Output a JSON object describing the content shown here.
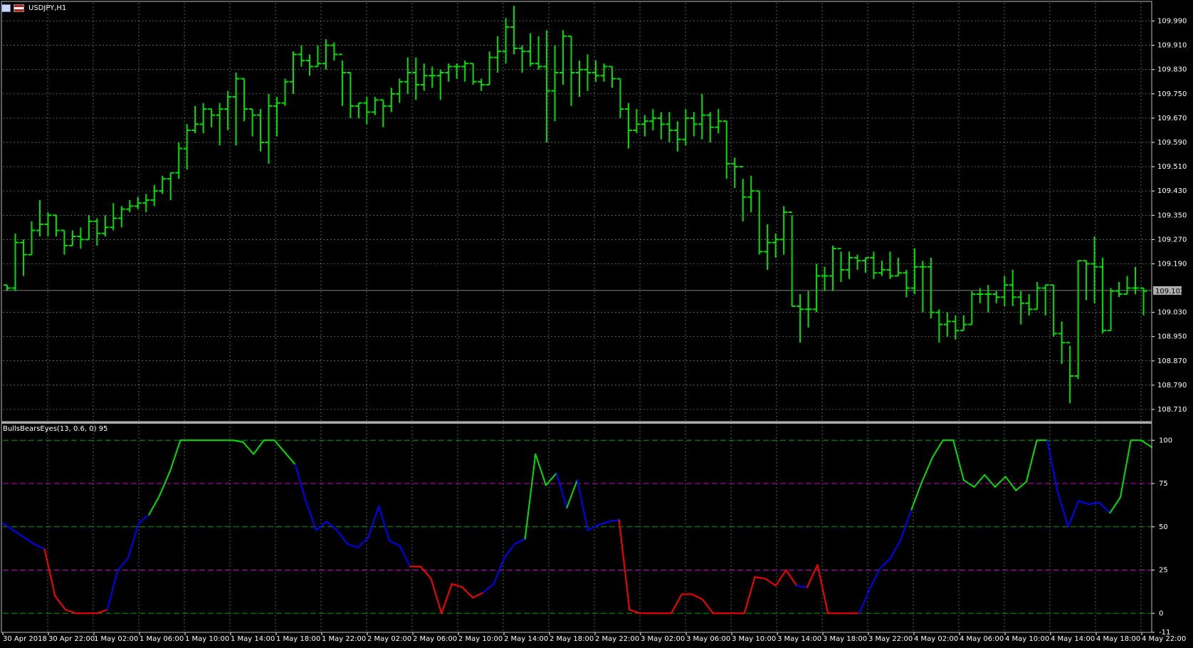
{
  "header": {
    "symbol_title": "USDJPY,H1"
  },
  "subwindow": {
    "title": "BullsBearsEyes(13, 0.6, 0) 95"
  },
  "price_axis": {
    "labels": [
      "109.990",
      "109.910",
      "109.830",
      "109.750",
      "109.670",
      "109.590",
      "109.510",
      "109.430",
      "109.350",
      "109.270",
      "109.190",
      "109.030",
      "108.950",
      "108.870",
      "108.790",
      "108.710"
    ],
    "current_price": "109.102"
  },
  "indicator_axis": {
    "labels": [
      "100",
      "75",
      "50",
      "25",
      "0",
      "-11"
    ]
  },
  "time_axis": {
    "labels": [
      "30 Apr 2018",
      "30 Apr 22:00",
      "1 May 02:00",
      "1 May 06:00",
      "1 May 10:00",
      "1 May 14:00",
      "1 May 18:00",
      "1 May 22:00",
      "2 May 02:00",
      "2 May 06:00",
      "2 May 10:00",
      "2 May 14:00",
      "2 May 18:00",
      "2 May 22:00",
      "3 May 02:00",
      "3 May 06:00",
      "3 May 10:00",
      "3 May 14:00",
      "3 May 18:00",
      "3 May 22:00",
      "4 May 02:00",
      "4 May 06:00",
      "4 May 10:00",
      "4 May 14:00",
      "4 May 18:00",
      "4 May 22:00"
    ]
  },
  "colors": {
    "background": "#000000",
    "grid": "#c0c0c0",
    "bars": "#00e000",
    "bull": "#00e000",
    "neutral": "#0000ff",
    "bear": "#ff0000",
    "level_75_25": "#c000c0",
    "level_100_50_0": "#00a000",
    "axis_text": "#ffffff"
  },
  "chart_data": [
    {
      "type": "ohlc",
      "symbol": "USDJPY",
      "timeframe": "H1",
      "ylim": [
        108.67,
        110.05
      ],
      "bars": [
        [
          109.12,
          109.12,
          109.1,
          109.11
        ],
        [
          109.11,
          109.29,
          109.1,
          109.26
        ],
        [
          109.26,
          109.27,
          109.15,
          109.22
        ],
        [
          109.22,
          109.33,
          109.22,
          109.3
        ],
        [
          109.3,
          109.4,
          109.28,
          109.32
        ],
        [
          109.32,
          109.36,
          109.28,
          109.35
        ],
        [
          109.35,
          109.35,
          109.28,
          109.3
        ],
        [
          109.3,
          109.3,
          109.22,
          109.25
        ],
        [
          109.25,
          109.3,
          109.25,
          109.28
        ],
        [
          109.28,
          109.31,
          109.24,
          109.27
        ],
        [
          109.27,
          109.35,
          109.27,
          109.33
        ],
        [
          109.33,
          109.34,
          109.25,
          109.29
        ],
        [
          109.29,
          109.35,
          109.28,
          109.31
        ],
        [
          109.31,
          109.39,
          109.3,
          109.34
        ],
        [
          109.34,
          109.38,
          109.31,
          109.37
        ],
        [
          109.37,
          109.4,
          109.36,
          109.38
        ],
        [
          109.38,
          109.41,
          109.37,
          109.39
        ],
        [
          109.39,
          109.42,
          109.36,
          109.4
        ],
        [
          109.4,
          109.45,
          109.38,
          109.43
        ],
        [
          109.43,
          109.48,
          109.42,
          109.47
        ],
        [
          109.47,
          109.49,
          109.4,
          109.49
        ],
        [
          109.49,
          109.59,
          109.47,
          109.57
        ],
        [
          109.57,
          109.65,
          109.5,
          109.63
        ],
        [
          109.63,
          109.71,
          109.62,
          109.65
        ],
        [
          109.65,
          109.72,
          109.62,
          109.7
        ],
        [
          109.7,
          109.7,
          109.64,
          109.68
        ],
        [
          109.68,
          109.72,
          109.58,
          109.7
        ],
        [
          109.7,
          109.76,
          109.63,
          109.74
        ],
        [
          109.74,
          109.82,
          109.58,
          109.8
        ],
        [
          109.8,
          109.8,
          109.66,
          109.7
        ],
        [
          109.7,
          109.7,
          109.61,
          109.68
        ],
        [
          109.68,
          109.7,
          109.56,
          109.59
        ],
        [
          109.59,
          109.75,
          109.52,
          109.71
        ],
        [
          109.71,
          109.74,
          109.61,
          109.72
        ],
        [
          109.72,
          109.8,
          109.71,
          109.79
        ],
        [
          109.79,
          109.89,
          109.75,
          109.88
        ],
        [
          109.88,
          109.91,
          109.84,
          109.86
        ],
        [
          109.86,
          109.88,
          109.81,
          109.84
        ],
        [
          109.84,
          109.91,
          109.84,
          109.85
        ],
        [
          109.85,
          109.93,
          109.83,
          109.91
        ],
        [
          109.91,
          109.92,
          109.86,
          109.88
        ],
        [
          109.88,
          109.86,
          109.71,
          109.82
        ],
        [
          109.82,
          109.82,
          109.67,
          109.71
        ],
        [
          109.71,
          109.72,
          109.67,
          109.72
        ],
        [
          109.72,
          109.74,
          109.65,
          109.69
        ],
        [
          109.69,
          109.74,
          109.68,
          109.73
        ],
        [
          109.73,
          109.73,
          109.64,
          109.71
        ],
        [
          109.71,
          109.77,
          109.69,
          109.75
        ],
        [
          109.75,
          109.8,
          109.72,
          109.79
        ],
        [
          109.79,
          109.87,
          109.75,
          109.82
        ],
        [
          109.82,
          109.87,
          109.73,
          109.78
        ],
        [
          109.78,
          109.85,
          109.76,
          109.81
        ],
        [
          109.81,
          109.84,
          109.77,
          109.81
        ],
        [
          109.81,
          109.83,
          109.73,
          109.82
        ],
        [
          109.82,
          109.85,
          109.79,
          109.84
        ],
        [
          109.84,
          109.85,
          109.8,
          109.84
        ],
        [
          109.84,
          109.86,
          109.79,
          109.85
        ],
        [
          109.85,
          109.85,
          109.78,
          109.79
        ],
        [
          109.79,
          109.8,
          109.76,
          109.78
        ],
        [
          109.78,
          109.89,
          109.78,
          109.87
        ],
        [
          109.87,
          109.94,
          109.82,
          109.89
        ],
        [
          109.89,
          110.0,
          109.85,
          109.97
        ],
        [
          109.97,
          110.04,
          109.88,
          109.9
        ],
        [
          109.9,
          109.91,
          109.82,
          109.89
        ],
        [
          109.89,
          109.95,
          109.84,
          109.85
        ],
        [
          109.85,
          109.94,
          109.83,
          109.84
        ],
        [
          109.84,
          109.96,
          109.59,
          109.76
        ],
        [
          109.76,
          109.91,
          109.66,
          109.82
        ],
        [
          109.82,
          109.96,
          109.78,
          109.94
        ],
        [
          109.94,
          109.94,
          109.71,
          109.82
        ],
        [
          109.82,
          109.86,
          109.74,
          109.83
        ],
        [
          109.83,
          109.88,
          109.76,
          109.82
        ],
        [
          109.82,
          109.86,
          109.79,
          109.81
        ],
        [
          109.81,
          109.85,
          109.79,
          109.84
        ],
        [
          109.84,
          109.84,
          109.77,
          109.8
        ],
        [
          109.8,
          109.8,
          109.67,
          109.7
        ],
        [
          109.7,
          109.72,
          109.57,
          109.63
        ],
        [
          109.63,
          109.7,
          109.62,
          109.65
        ],
        [
          109.65,
          109.68,
          109.61,
          109.66
        ],
        [
          109.66,
          109.7,
          109.63,
          109.67
        ],
        [
          109.67,
          109.69,
          109.6,
          109.65
        ],
        [
          109.65,
          109.69,
          109.59,
          109.63
        ],
        [
          109.63,
          109.66,
          109.56,
          109.6
        ],
        [
          109.6,
          109.7,
          109.58,
          109.67
        ],
        [
          109.67,
          109.69,
          109.61,
          109.65
        ],
        [
          109.65,
          109.75,
          109.6,
          109.68
        ],
        [
          109.68,
          109.69,
          109.59,
          109.64
        ],
        [
          109.64,
          109.7,
          109.62,
          109.66
        ],
        [
          109.66,
          109.66,
          109.47,
          109.52
        ],
        [
          109.52,
          109.54,
          109.44,
          109.51
        ],
        [
          109.51,
          109.47,
          109.33,
          109.41
        ],
        [
          109.41,
          109.48,
          109.36,
          109.43
        ],
        [
          109.43,
          109.43,
          109.22,
          109.23
        ],
        [
          109.23,
          109.32,
          109.17,
          109.26
        ],
        [
          109.26,
          109.29,
          109.21,
          109.27
        ],
        [
          109.27,
          109.38,
          109.22,
          109.36
        ],
        [
          109.36,
          109.35,
          109.05,
          109.05
        ],
        [
          109.05,
          109.09,
          108.93,
          109.04
        ],
        [
          109.04,
          109.1,
          108.98,
          109.04
        ],
        [
          109.04,
          109.19,
          109.03,
          109.15
        ],
        [
          109.15,
          109.18,
          109.1,
          109.15
        ],
        [
          109.15,
          109.25,
          109.1,
          109.24
        ],
        [
          109.24,
          109.23,
          109.13,
          109.17
        ],
        [
          109.17,
          109.23,
          109.14,
          109.21
        ],
        [
          109.21,
          109.22,
          109.17,
          109.2
        ],
        [
          109.2,
          109.21,
          109.16,
          109.21
        ],
        [
          109.21,
          109.23,
          109.14,
          109.16
        ],
        [
          109.16,
          109.2,
          109.15,
          109.17
        ],
        [
          109.17,
          109.23,
          109.14,
          109.15
        ],
        [
          109.15,
          109.21,
          109.15,
          109.16
        ],
        [
          109.16,
          109.17,
          109.08,
          109.11
        ],
        [
          109.11,
          109.24,
          109.09,
          109.18
        ],
        [
          109.18,
          109.2,
          109.03,
          109.18
        ],
        [
          109.18,
          109.21,
          109.01,
          109.03
        ],
        [
          109.03,
          109.04,
          108.93,
          108.99
        ],
        [
          108.99,
          109.03,
          108.95,
          109.0
        ],
        [
          109.0,
          109.02,
          108.94,
          108.97
        ],
        [
          108.97,
          109.02,
          108.97,
          108.99
        ],
        [
          108.99,
          109.1,
          108.99,
          109.09
        ],
        [
          109.09,
          109.11,
          109.06,
          109.09
        ],
        [
          109.09,
          109.12,
          109.03,
          109.09
        ],
        [
          109.09,
          109.1,
          109.06,
          109.08
        ],
        [
          109.08,
          109.15,
          109.05,
          109.12
        ],
        [
          109.12,
          109.17,
          109.05,
          109.08
        ],
        [
          109.08,
          109.1,
          108.99,
          109.06
        ],
        [
          109.06,
          109.09,
          109.02,
          109.04
        ],
        [
          109.04,
          109.13,
          109.04,
          109.11
        ],
        [
          109.11,
          109.12,
          109.02,
          109.12
        ],
        [
          109.12,
          109.12,
          108.95,
          108.96
        ],
        [
          108.96,
          109.0,
          108.86,
          108.93
        ],
        [
          108.93,
          108.92,
          108.73,
          108.82
        ],
        [
          108.82,
          109.2,
          108.81,
          109.2
        ],
        [
          109.2,
          109.2,
          109.07,
          109.19
        ],
        [
          109.19,
          109.28,
          109.06,
          109.18
        ],
        [
          109.18,
          109.21,
          108.96,
          108.97
        ],
        [
          108.97,
          109.11,
          108.97,
          109.1
        ],
        [
          109.1,
          109.13,
          109.08,
          109.09
        ],
        [
          109.09,
          109.15,
          109.09,
          109.11
        ],
        [
          109.11,
          109.18,
          109.09,
          109.11
        ],
        [
          109.11,
          109.11,
          109.02,
          109.1
        ]
      ]
    },
    {
      "type": "line",
      "name": "BullsBearsEyes(13, 0.6, 0) 95",
      "ylim": [
        -11,
        110
      ],
      "levels": [
        100,
        75,
        50,
        25,
        0
      ],
      "values": [
        52,
        48,
        44,
        40,
        37,
        10,
        2,
        0,
        0,
        0,
        2,
        25,
        32,
        52,
        57,
        68,
        82,
        100,
        100,
        100,
        100,
        100,
        100,
        99,
        92,
        100,
        100,
        93,
        86,
        65,
        48,
        53,
        48,
        40,
        38,
        44,
        62,
        42,
        39,
        27,
        27,
        20,
        0,
        17,
        15,
        9,
        12,
        17,
        32,
        40,
        43,
        92,
        74,
        81,
        61,
        77,
        48,
        51,
        53,
        54,
        2,
        0,
        0,
        0,
        0,
        11,
        11,
        8,
        0,
        0,
        0,
        0,
        21,
        20,
        16,
        25,
        16,
        15,
        28,
        0,
        0,
        0,
        0,
        14,
        26,
        32,
        43,
        60,
        76,
        90,
        100,
        100,
        77,
        73,
        80,
        73,
        79,
        71,
        76,
        100,
        100,
        70,
        50,
        65,
        63,
        64,
        58,
        67,
        100,
        100,
        96
      ],
      "colors": [
        "neutral",
        "neutral",
        "neutral",
        "neutral",
        "neutral",
        "bear",
        "bear",
        "bear",
        "bear",
        "bear",
        "bear",
        "neutral",
        "neutral",
        "neutral",
        "neutral",
        "bull",
        "bull",
        "bull",
        "bull",
        "bull",
        "bull",
        "bull",
        "bull",
        "bull",
        "bull",
        "bull",
        "bull",
        "bull",
        "bull",
        "neutral",
        "neutral",
        "neutral",
        "neutral",
        "neutral",
        "neutral",
        "neutral",
        "neutral",
        "neutral",
        "neutral",
        "neutral",
        "bear",
        "bear",
        "bear",
        "bear",
        "bear",
        "bear",
        "bear",
        "neutral",
        "neutral",
        "neutral",
        "neutral",
        "bull",
        "bull",
        "bull",
        "neutral",
        "bull",
        "neutral",
        "neutral",
        "neutral",
        "neutral",
        "bear",
        "bear",
        "bear",
        "bear",
        "bear",
        "bear",
        "bear",
        "bear",
        "bear",
        "bear",
        "bear",
        "bear",
        "bear",
        "bear",
        "bear",
        "bear",
        "bear",
        "neutral",
        "bear",
        "bear",
        "bear",
        "bear",
        "bear",
        "neutral",
        "neutral",
        "neutral",
        "neutral",
        "neutral",
        "bull",
        "bull",
        "bull",
        "bull",
        "bull",
        "bull",
        "bull",
        "bull",
        "bull",
        "bull",
        "bull",
        "bull",
        "bull",
        "neutral",
        "neutral",
        "neutral",
        "neutral",
        "neutral",
        "neutral",
        "bull",
        "bull",
        "bull",
        "bull"
      ]
    }
  ]
}
